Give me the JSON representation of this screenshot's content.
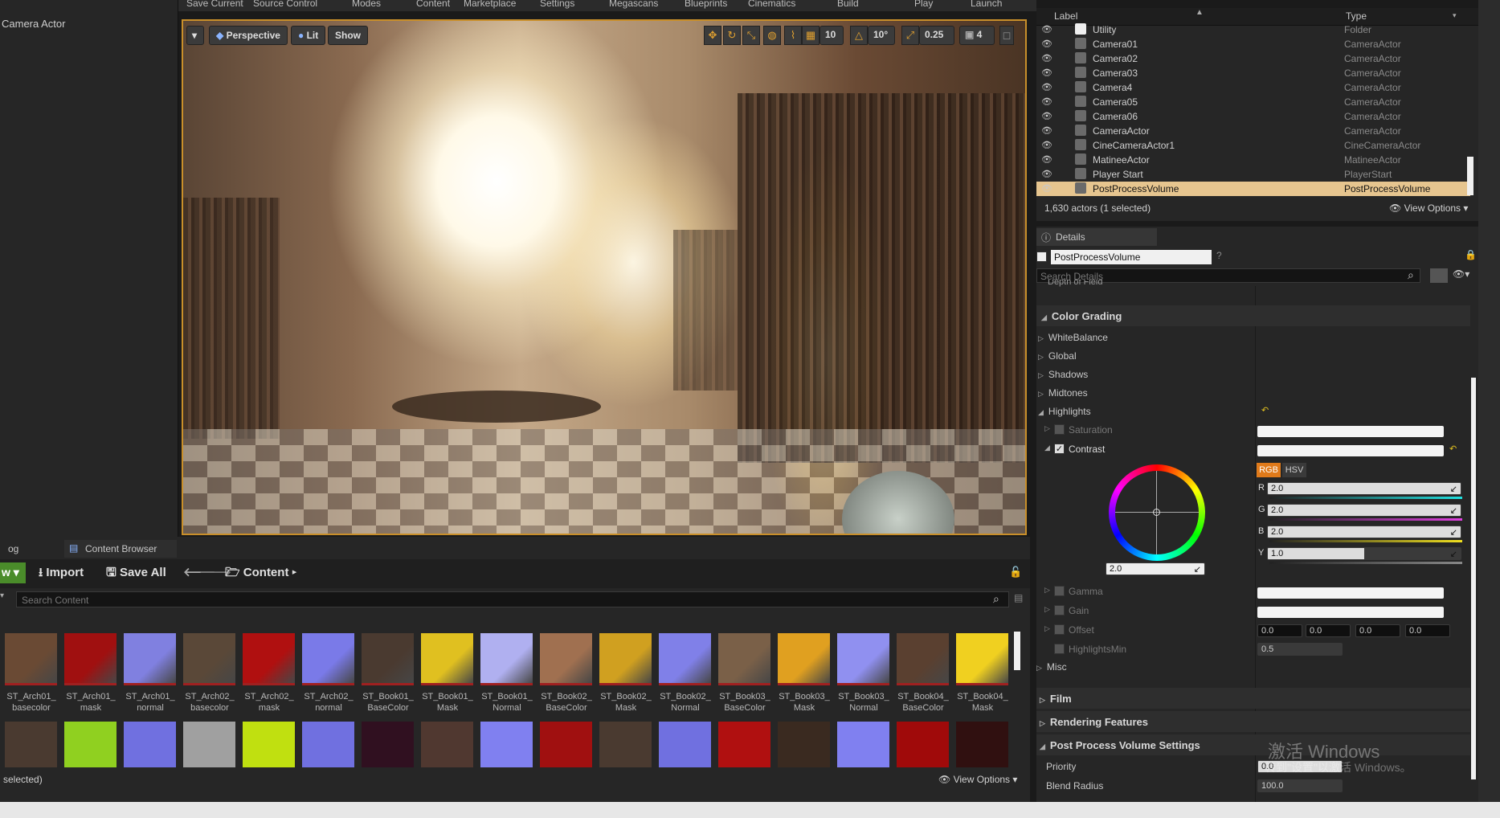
{
  "menu": [
    "Save Current",
    "Source Control",
    "Modes",
    "Content",
    "Marketplace",
    "Settings",
    "Megascans",
    "Blueprints",
    "Cinematics",
    "Build",
    "Play",
    "Launch"
  ],
  "left_panel": {
    "title": "Camera Actor"
  },
  "viewport": {
    "perspective_label": "Perspective",
    "lit_label": "Lit",
    "show_label": "Show",
    "grid_snap": "10",
    "rot_snap": "10°",
    "scale_snap": "0.25",
    "camera_speed": "4"
  },
  "outliner": {
    "col_label": "Label",
    "col_type": "Type",
    "rows": [
      {
        "label": "Utility",
        "type": "Folder"
      },
      {
        "label": "Camera01",
        "type": "CameraActor"
      },
      {
        "label": "Camera02",
        "type": "CameraActor"
      },
      {
        "label": "Camera03",
        "type": "CameraActor"
      },
      {
        "label": "Camera4",
        "type": "CameraActor"
      },
      {
        "label": "Camera05",
        "type": "CameraActor"
      },
      {
        "label": "Camera06",
        "type": "CameraActor"
      },
      {
        "label": "CameraActor",
        "type": "CameraActor"
      },
      {
        "label": "CineCameraActor1",
        "type": "CineCameraActor"
      },
      {
        "label": "MatineeActor",
        "type": "MatineeActor"
      },
      {
        "label": "Player Start",
        "type": "PlayerStart"
      },
      {
        "label": "PostProcessVolume",
        "type": "PostProcessVolume"
      }
    ],
    "selected_index": 11,
    "status": "1,630 actors (1 selected)",
    "view_options": "View Options"
  },
  "details": {
    "tab": "Details",
    "object_name": "PostProcessVolume",
    "search_placeholder": "Search Details",
    "cut_row": "Depth of Field",
    "color_grading": "Color Grading",
    "sub_items": [
      "WhiteBalance",
      "Global",
      "Shadows",
      "Midtones",
      "Highlights"
    ],
    "saturation": "Saturation",
    "contrast": "Contrast",
    "rgb": "RGB",
    "hsv": "HSV",
    "channels": [
      {
        "ch": "R",
        "value": "2.0"
      },
      {
        "ch": "G",
        "value": "2.0"
      },
      {
        "ch": "B",
        "value": "2.0"
      },
      {
        "ch": "Y",
        "value": "1.0"
      }
    ],
    "wheel_value": "2.0",
    "gamma": "Gamma",
    "gain": "Gain",
    "offset": "Offset",
    "offset_values": [
      "0.0",
      "0.0",
      "0.0",
      "0.0"
    ],
    "highlights_min": "HighlightsMin",
    "highlights_min_value": "0.5",
    "misc": "Misc",
    "film": "Film",
    "rendering_features": "Rendering Features",
    "ppv_settings": "Post Process Volume Settings",
    "priority": "Priority",
    "priority_value": "0.0",
    "blend_radius": "Blend Radius",
    "blend_radius_value": "100.0"
  },
  "content_browser": {
    "tab_log": "og",
    "tab": "Content Browser",
    "new_label": "w",
    "import_label": "Import",
    "save_all_label": "Save All",
    "path": "Content",
    "search_placeholder": "Search Content",
    "status": "selected)",
    "view_options": "View Options",
    "assets_row1": [
      {
        "name": "ST_Arch01_\nbasecolor",
        "color": "#6a4a34"
      },
      {
        "name": "ST_Arch01_\nmask",
        "color": "#a01010"
      },
      {
        "name": "ST_Arch01_\nnormal",
        "color": "#8080e0"
      },
      {
        "name": "ST_Arch02_\nbasecolor",
        "color": "#5a4838"
      },
      {
        "name": "ST_Arch02_\nmask",
        "color": "#b01010"
      },
      {
        "name": "ST_Arch02_\nnormal",
        "color": "#7a7ae8"
      },
      {
        "name": "ST_Book01_\nBaseColor",
        "color": "#4a3a30"
      },
      {
        "name": "ST_Book01_\nMask",
        "color": "#e0c020"
      },
      {
        "name": "ST_Book01_\nNormal",
        "color": "#b0b0f0"
      },
      {
        "name": "ST_Book02_\nBaseColor",
        "color": "#a07050"
      },
      {
        "name": "ST_Book02_\nMask",
        "color": "#d0a020"
      },
      {
        "name": "ST_Book02_\nNormal",
        "color": "#8080e8"
      },
      {
        "name": "ST_Book03_\nBaseColor",
        "color": "#7a6048"
      },
      {
        "name": "ST_Book03_\nMask",
        "color": "#e0a020"
      },
      {
        "name": "ST_Book03_\nNormal",
        "color": "#9090f0"
      },
      {
        "name": "ST_Book04_\nBaseColor",
        "color": "#5a4030"
      },
      {
        "name": "ST_Book04_\nMask",
        "color": "#f0d020"
      }
    ],
    "assets_row2_colors": [
      "#4a3a30",
      "#90d020",
      "#7070e0",
      "#a0a0a0",
      "#c0e010",
      "#7070e0",
      "#301020",
      "#503830",
      "#8080f0",
      "#a01010",
      "#4a3a30",
      "#7070e0",
      "#b01010",
      "#3a2a20",
      "#8080f0",
      "#a00a0a",
      "#301010"
    ]
  },
  "watermark": {
    "line1": "激活 Windows",
    "line2": "转到\"设置\"以激活 Windows。"
  }
}
